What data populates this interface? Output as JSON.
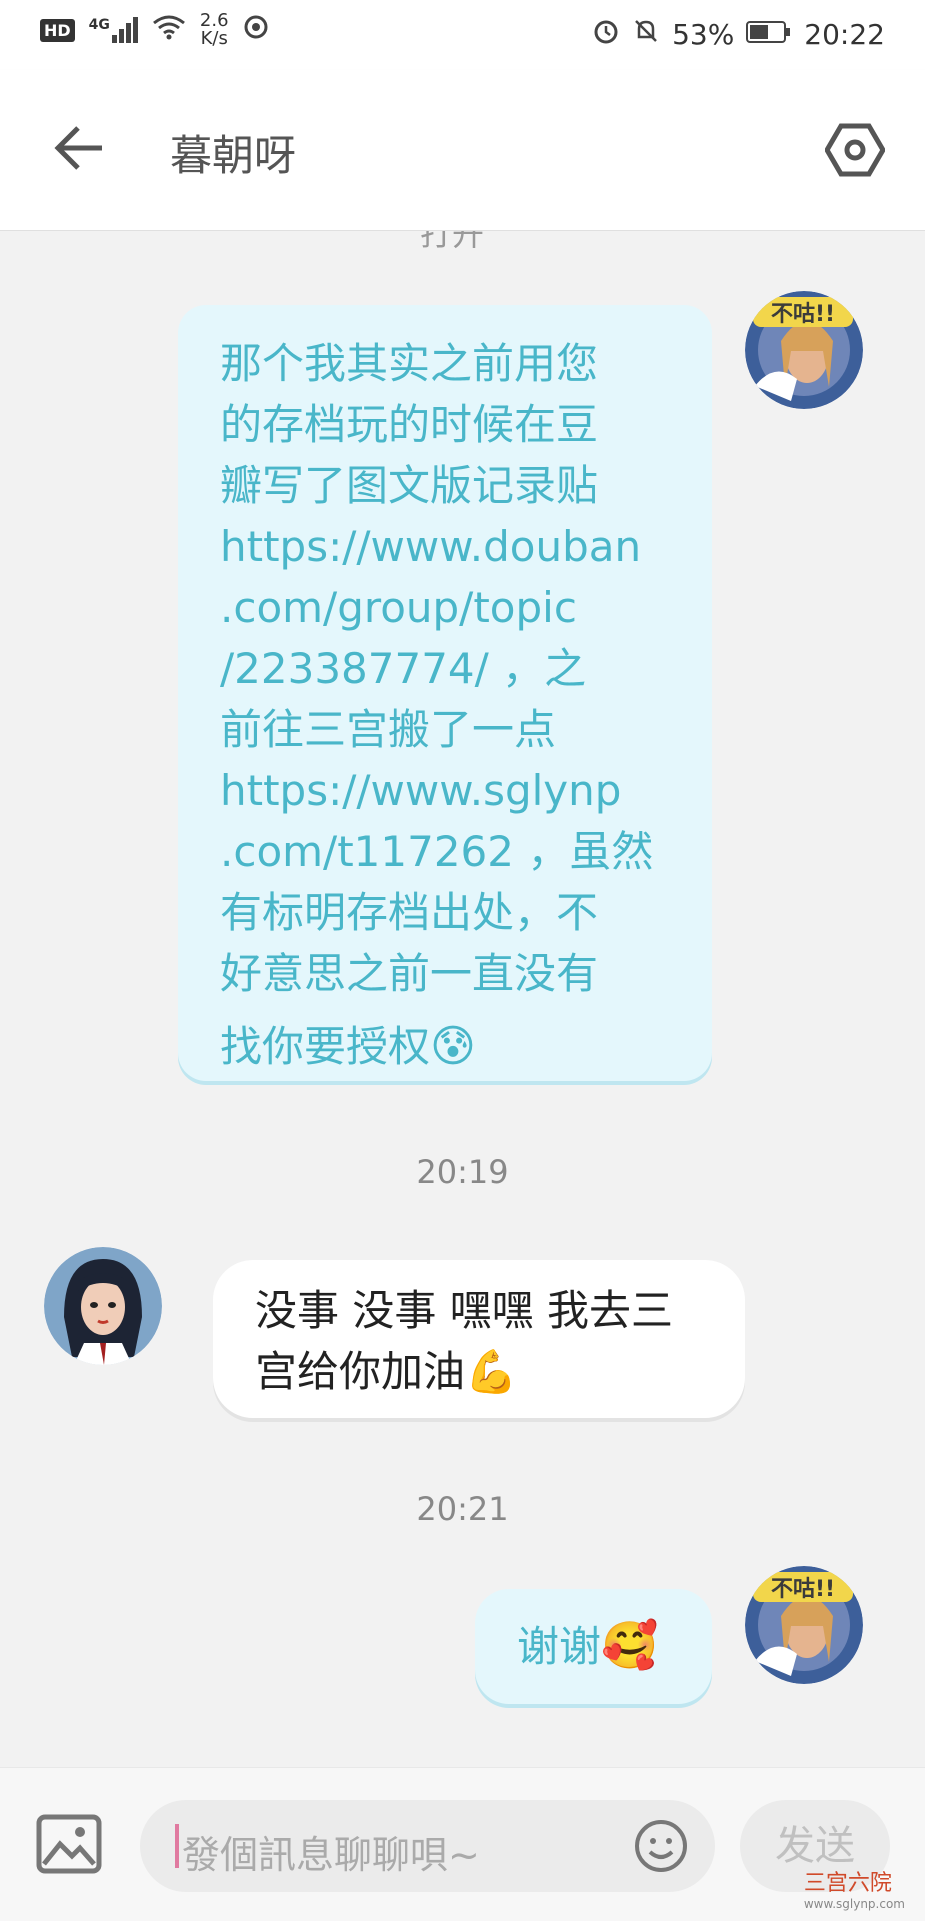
{
  "status_bar": {
    "network_label": "HD",
    "signal_label": "4G",
    "speed_value": "2.6",
    "speed_unit": "K/s",
    "battery": "53%",
    "time": "20:22"
  },
  "header": {
    "title": "暮朝呀",
    "cut_text": "打开"
  },
  "messages": [
    {
      "side": "right",
      "lines": [
        "那个我其实之前用您",
        "的存档玩的时候在豆",
        "瓣写了图文版记录贴",
        "https://www.douban",
        ".com/group/topic",
        "/223387774/ ，之",
        "前往三宫搬了一点",
        "https://www.sglynp",
        ".com/t117262 ，虽然",
        "有标明存档出处，不",
        "好意思之前一直没有",
        "找你要授权"
      ],
      "emoji": "😰"
    },
    {
      "timestamp": "20:19"
    },
    {
      "side": "left",
      "lines": [
        "没事 没事 嘿嘿 我去三",
        "宫给你加油"
      ],
      "emoji": "💪"
    },
    {
      "timestamp": "20:21"
    },
    {
      "side": "right",
      "lines": [
        "谢谢"
      ],
      "emoji": "🥰"
    }
  ],
  "input_bar": {
    "placeholder": "發個訊息聊聊唄~",
    "send_label": "发送"
  },
  "avatar_badge_text": "不咕!!",
  "watermark": {
    "text": "三宫六院",
    "url": "www.sglynp.com"
  },
  "colors": {
    "bubble_right_bg": "#e4f7fc",
    "bubble_right_text": "#49b6c9",
    "bubble_left_bg": "#ffffff",
    "timestamp": "#888888"
  }
}
